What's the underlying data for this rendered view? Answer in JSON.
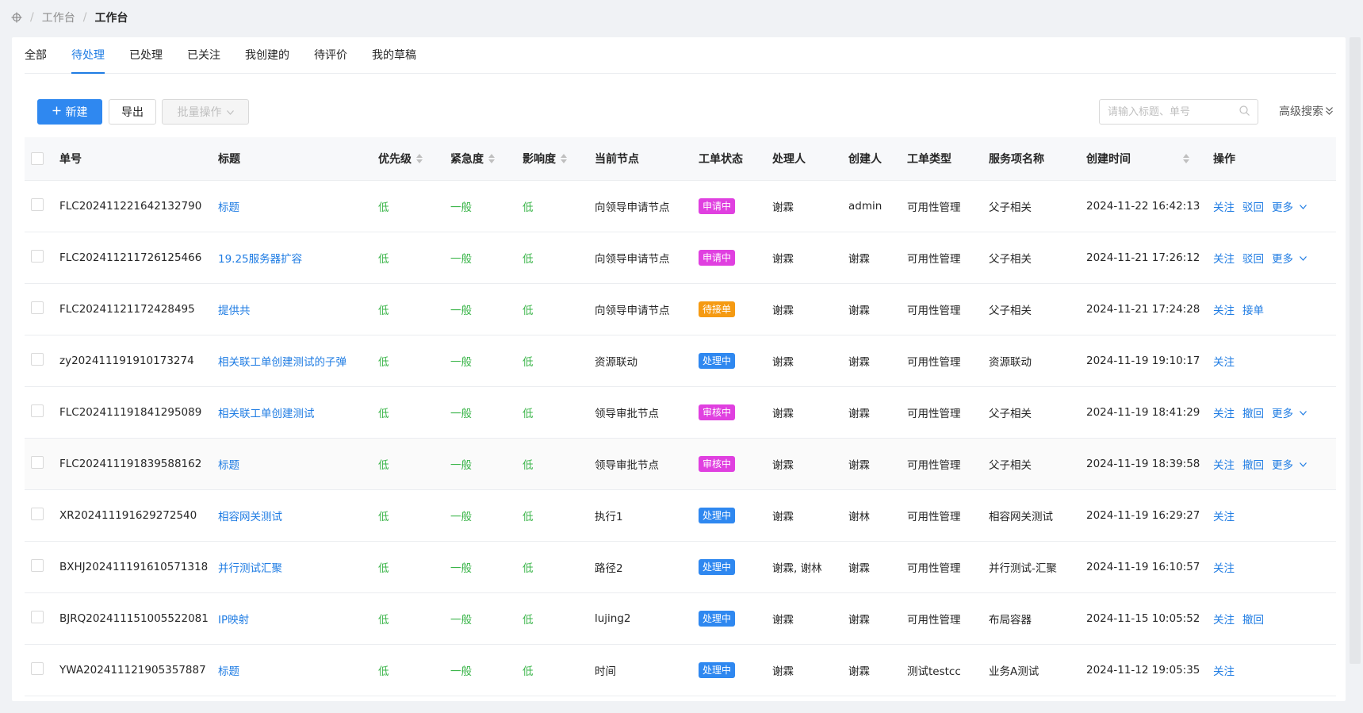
{
  "breadcrumb": {
    "items": [
      "工作台",
      "工作台"
    ]
  },
  "tabs": [
    "全部",
    "待处理",
    "已处理",
    "已关注",
    "我创建的",
    "待评价",
    "我的草稿"
  ],
  "active_tab": "待处理",
  "toolbar": {
    "new_label": "新建",
    "export_label": "导出",
    "batch_label": "批量操作",
    "search_placeholder": "请输入标题、单号",
    "advanced_search_label": "高级搜索"
  },
  "table": {
    "headers": {
      "no": "单号",
      "title": "标题",
      "priority": "优先级",
      "urgency": "紧急度",
      "impact": "影响度",
      "node": "当前节点",
      "status": "工单状态",
      "handler": "处理人",
      "creator": "创建人",
      "type": "工单类型",
      "service": "服务项名称",
      "created_at": "创建时间",
      "ops": "操作"
    },
    "rows": [
      {
        "no": "FLC202411221642132790",
        "title": "标题",
        "priority": "低",
        "urgency": "一般",
        "impact": "低",
        "node": "向领导申请节点",
        "status": "申请中",
        "status_color": "#e040e0",
        "handler": "谢霖",
        "creator": "admin",
        "type": "可用性管理",
        "service": "父子相关",
        "created_at": "2024-11-22 16:42:13",
        "ops": [
          "关注",
          "驳回",
          "更多"
        ]
      },
      {
        "no": "FLC202411211726125466",
        "title": "19.25服务器扩容",
        "priority": "低",
        "urgency": "一般",
        "impact": "低",
        "node": "向领导申请节点",
        "status": "申请中",
        "status_color": "#e040e0",
        "handler": "谢霖",
        "creator": "谢霖",
        "type": "可用性管理",
        "service": "父子相关",
        "created_at": "2024-11-21 17:26:12",
        "ops": [
          "关注",
          "驳回",
          "更多"
        ]
      },
      {
        "no": "FLC20241121172428495",
        "title": "提供共",
        "priority": "低",
        "urgency": "一般",
        "impact": "低",
        "node": "向领导申请节点",
        "status": "待接单",
        "status_color": "#f59a12",
        "handler": "谢霖",
        "creator": "谢霖",
        "type": "可用性管理",
        "service": "父子相关",
        "created_at": "2024-11-21 17:24:28",
        "ops": [
          "关注",
          "接单"
        ]
      },
      {
        "no": "zy202411191910173274",
        "title": "相关联工单创建测试的子弹",
        "priority": "低",
        "urgency": "一般",
        "impact": "低",
        "node": "资源联动",
        "status": "处理中",
        "status_color": "#2f88f0",
        "handler": "谢霖",
        "creator": "谢霖",
        "type": "可用性管理",
        "service": "资源联动",
        "created_at": "2024-11-19 19:10:17",
        "ops": [
          "关注"
        ]
      },
      {
        "no": "FLC202411191841295089",
        "title": "相关联工单创建测试",
        "priority": "低",
        "urgency": "一般",
        "impact": "低",
        "node": "领导审批节点",
        "status": "审核中",
        "status_color": "#e040e0",
        "handler": "谢霖",
        "creator": "谢霖",
        "type": "可用性管理",
        "service": "父子相关",
        "created_at": "2024-11-19 18:41:29",
        "ops": [
          "关注",
          "撤回",
          "更多"
        ]
      },
      {
        "no": "FLC202411191839588162",
        "title": "标题",
        "priority": "低",
        "urgency": "一般",
        "impact": "低",
        "node": "领导审批节点",
        "status": "审核中",
        "status_color": "#e040e0",
        "handler": "谢霖",
        "creator": "谢霖",
        "type": "可用性管理",
        "service": "父子相关",
        "created_at": "2024-11-19 18:39:58",
        "ops": [
          "关注",
          "撤回",
          "更多"
        ]
      },
      {
        "no": "XR202411191629272540",
        "title": "相容网关测试",
        "priority": "低",
        "urgency": "一般",
        "impact": "低",
        "node": "执行1",
        "status": "处理中",
        "status_color": "#2f88f0",
        "handler": "谢霖",
        "creator": "谢林",
        "type": "可用性管理",
        "service": "相容网关测试",
        "created_at": "2024-11-19 16:29:27",
        "ops": [
          "关注"
        ]
      },
      {
        "no": "BXHJ202411191610571318",
        "title": "并行测试汇聚",
        "priority": "低",
        "urgency": "一般",
        "impact": "低",
        "node": "路径2",
        "status": "处理中",
        "status_color": "#2f88f0",
        "handler": "谢霖, 谢林",
        "creator": "谢霖",
        "type": "可用性管理",
        "service": "并行测试-汇聚",
        "created_at": "2024-11-19 16:10:57",
        "ops": [
          "关注"
        ]
      },
      {
        "no": "BJRQ202411151005522081",
        "title": "IP映射",
        "priority": "低",
        "urgency": "一般",
        "impact": "低",
        "node": "lujing2",
        "status": "处理中",
        "status_color": "#2f88f0",
        "handler": "谢霖",
        "creator": "谢霖",
        "type": "可用性管理",
        "service": "布局容器",
        "created_at": "2024-11-15 10:05:52",
        "ops": [
          "关注",
          "撤回"
        ]
      },
      {
        "no": "YWA202411121905357887",
        "title": "标题",
        "priority": "低",
        "urgency": "一般",
        "impact": "低",
        "node": "时间",
        "status": "处理中",
        "status_color": "#2f88f0",
        "handler": "谢霖",
        "creator": "谢霖",
        "type": "测试testcc",
        "service": "业务A测试",
        "created_at": "2024-11-12 19:05:35",
        "ops": [
          "关注"
        ]
      }
    ]
  },
  "colors": {
    "accent": "#1f7ce3",
    "primary_button": "#2f88f0",
    "low_priority": "#3bb54a"
  },
  "icons": {
    "breadcrumb": "crosshair-icon",
    "new": "plus-icon",
    "batch": "chevron-down-icon",
    "search": "search-icon",
    "advanced": "double-chevron-down-icon",
    "more": "chevron-down-icon"
  }
}
